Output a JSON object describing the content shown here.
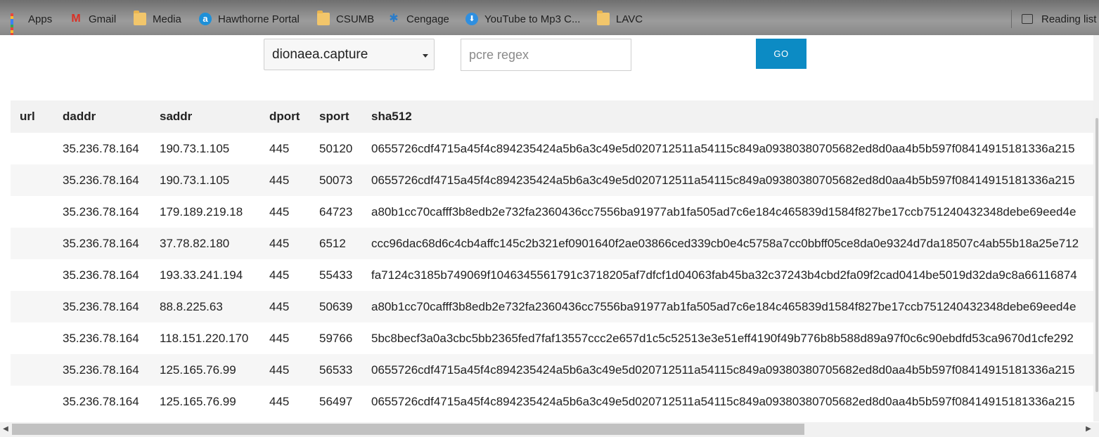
{
  "bookmarks": [
    {
      "label": "Apps",
      "icon": "apps-grid-icon"
    },
    {
      "label": "Gmail",
      "icon": "gmail-icon"
    },
    {
      "label": "Media",
      "icon": "folder-icon"
    },
    {
      "label": "Hawthorne Portal",
      "icon": "hawthorne-icon"
    },
    {
      "label": "CSUMB",
      "icon": "folder-icon"
    },
    {
      "label": "Cengage",
      "icon": "cengage-icon"
    },
    {
      "label": "YouTube to Mp3 C...",
      "icon": "download-icon"
    },
    {
      "label": "LAVC",
      "icon": "folder-icon"
    }
  ],
  "reading_list": {
    "label": "Reading list",
    "icon": "reading-list-icon"
  },
  "query": {
    "collection_selected": "dionaea.capture",
    "regex_placeholder": "pcre regex",
    "regex_value": "",
    "go_label": "GO"
  },
  "table": {
    "headers": {
      "url": "url",
      "daddr": "daddr",
      "saddr": "saddr",
      "dport": "dport",
      "sport": "sport",
      "sha512": "sha512"
    },
    "rows": [
      {
        "url": "",
        "daddr": "35.236.78.164",
        "saddr": "190.73.1.105",
        "dport": "445",
        "sport": "50120",
        "sha512": "0655726cdf4715a45f4c894235424a5b6a3c49e5d020712511a54115c849a09380380705682ed8d0aa4b5b597f08414915181336a215"
      },
      {
        "url": "",
        "daddr": "35.236.78.164",
        "saddr": "190.73.1.105",
        "dport": "445",
        "sport": "50073",
        "sha512": "0655726cdf4715a45f4c894235424a5b6a3c49e5d020712511a54115c849a09380380705682ed8d0aa4b5b597f08414915181336a215"
      },
      {
        "url": "",
        "daddr": "35.236.78.164",
        "saddr": "179.189.219.18",
        "dport": "445",
        "sport": "64723",
        "sha512": "a80b1cc70cafff3b8edb2e732fa2360436cc7556ba91977ab1fa505ad7c6e184c465839d1584f827be17ccb751240432348debe69eed4e"
      },
      {
        "url": "",
        "daddr": "35.236.78.164",
        "saddr": "37.78.82.180",
        "dport": "445",
        "sport": "6512",
        "sha512": "ccc96dac68d6c4cb4affc145c2b321ef0901640f2ae03866ced339cb0e4c5758a7cc0bbff05ce8da0e9324d7da18507c4ab55b18a25e712"
      },
      {
        "url": "",
        "daddr": "35.236.78.164",
        "saddr": "193.33.241.194",
        "dport": "445",
        "sport": "55433",
        "sha512": "fa7124c3185b749069f1046345561791c3718205af7dfcf1d04063fab45ba32c37243b4cbd2fa09f2cad0414be5019d32da9c8a66116874"
      },
      {
        "url": "",
        "daddr": "35.236.78.164",
        "saddr": "88.8.225.63",
        "dport": "445",
        "sport": "50639",
        "sha512": "a80b1cc70cafff3b8edb2e732fa2360436cc7556ba91977ab1fa505ad7c6e184c465839d1584f827be17ccb751240432348debe69eed4e"
      },
      {
        "url": "",
        "daddr": "35.236.78.164",
        "saddr": "118.151.220.170",
        "dport": "445",
        "sport": "59766",
        "sha512": "5bc8becf3a0a3cbc5bb2365fed7faf13557ccc2e657d1c5c52513e3e51eff4190f49b776b8b588d89a97f0c6c90ebdfd53ca9670d1cfe292"
      },
      {
        "url": "",
        "daddr": "35.236.78.164",
        "saddr": "125.165.76.99",
        "dport": "445",
        "sport": "56533",
        "sha512": "0655726cdf4715a45f4c894235424a5b6a3c49e5d020712511a54115c849a09380380705682ed8d0aa4b5b597f08414915181336a215"
      },
      {
        "url": "",
        "daddr": "35.236.78.164",
        "saddr": "125.165.76.99",
        "dport": "445",
        "sport": "56497",
        "sha512": "0655726cdf4715a45f4c894235424a5b6a3c49e5d020712511a54115c849a09380380705682ed8d0aa4b5b597f08414915181336a215"
      }
    ]
  },
  "colors": {
    "go_button": "#0c8bc4",
    "header_bg": "#f2f2f2",
    "row_stripe": "#f6f6f6"
  }
}
